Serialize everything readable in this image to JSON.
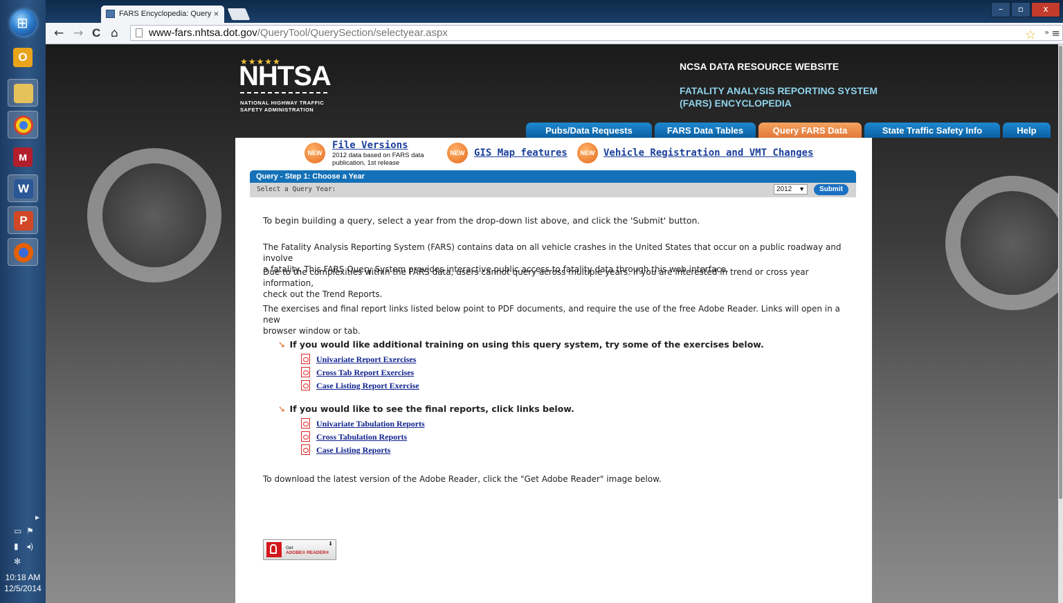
{
  "taskbar": {
    "apps": [
      {
        "name": "outlook",
        "glyph": "O",
        "color": "#e8a41b"
      },
      {
        "name": "file-explorer",
        "glyph": "",
        "color": "#e6c25b"
      },
      {
        "name": "chrome",
        "glyph": "",
        "color": "#db3e2a"
      },
      {
        "name": "mendeley",
        "glyph": "ᴍ",
        "color": "#b31e2c"
      },
      {
        "name": "word",
        "glyph": "W",
        "color": "#2b5797"
      },
      {
        "name": "powerpoint",
        "glyph": "P",
        "color": "#d24726"
      },
      {
        "name": "firefox",
        "glyph": "",
        "color": "#e66000"
      }
    ],
    "clock": {
      "time": "10:18 AM",
      "date": "12/5/2014"
    }
  },
  "browser": {
    "tab_title": "FARS Encyclopedia: Query",
    "tab_close": "×",
    "url_host": "www-fars.nhtsa.dot.gov",
    "url_path": "/QueryTool/QuerySection/selectyear.aspx",
    "back": "←",
    "forward": "→",
    "reload": "C",
    "home": "⌂",
    "star": "☆",
    "more": "»",
    "menu": "≡",
    "window": {
      "minimize": "–",
      "maximize": "▫",
      "close": "x"
    }
  },
  "header": {
    "stars": "★★★★★",
    "logo": "NHTSA",
    "logo_sub_1": "NATIONAL HIGHWAY TRAFFIC",
    "logo_sub_2": "SAFETY ADMINISTRATION",
    "site_title": "NCSA DATA RESOURCE WEBSITE",
    "site_sub_1": "FATALITY ANALYSIS REPORTING SYSTEM",
    "site_sub_2": "(FARS) ENCYCLOPEDIA"
  },
  "nav": [
    {
      "label": "Pubs/Data Requests",
      "active": false
    },
    {
      "label": "FARS Data Tables",
      "active": false
    },
    {
      "label": "Query FARS Data",
      "active": true
    },
    {
      "label": "State Traffic Safety Info",
      "active": false
    },
    {
      "label": "Help",
      "active": false
    }
  ],
  "news": {
    "badge": "NEW",
    "file_versions": "File Versions",
    "file_versions_desc_1": "2012 data based on FARS data",
    "file_versions_desc_2": "publication, 1st release",
    "gis": "GIS Map features",
    "vehicle": "Vehicle Registration and VMT Changes"
  },
  "query": {
    "step_title": "Query - Step 1: Choose a Year",
    "year_label": "Select a Query Year:",
    "year_value": "2012",
    "submit": "Submit"
  },
  "content": {
    "intro": "To begin building a query, select a year from the drop-down list above, and click the 'Submit' button.",
    "para1_line1": "The Fatality Analysis Reporting System (FARS) contains data on all vehicle crashes in the United States that occur on a public roadway and involve",
    "para1_line2": "a fatality. This FARS Query System provides interactive public access to fatality data through this web interface.",
    "para2_line1": "Due to the complexities within the FARS data, users cannot query across multiple years. If you are interested in trend or cross year information,",
    "para2_line2": "check out the Trend Reports.",
    "para3_line1": "The exercises and final report links listed below point to PDF documents, and require the use of the free Adobe Reader. Links will open in a new",
    "para3_line2": "browser window or tab.",
    "training_title": "If you would like additional training on using this query system, try some of the exercises below.",
    "training_links": [
      "Univariate Report Exercises",
      "Cross Tab Report Exercises",
      "Case Listing Report Exercise"
    ],
    "reports_title": "If you would like to see the final reports, click links below.",
    "report_links": [
      "Univariate Tabulation Reports",
      "Cross Tabulation Reports",
      "Case Listing Reports"
    ],
    "adobe_note": "To download the latest version of the Adobe Reader, click the \"Get Adobe Reader\" image below.",
    "adobe_get": "Get",
    "adobe_brand": "ADOBE® READER®"
  }
}
